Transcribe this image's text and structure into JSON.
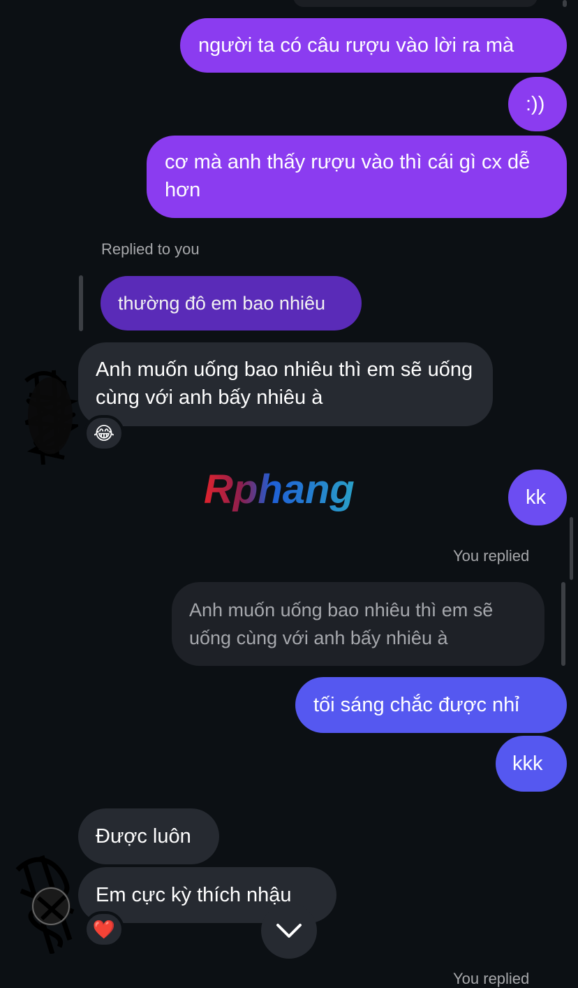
{
  "messages": {
    "m1": "người ta có câu rượu vào lời ra mà",
    "m2": ":))",
    "m3": "cơ mà anh thấy rượu vào thì cái gì cx dễ hơn",
    "replied_to_label": "Replied to you",
    "quoted1": "thường đô em bao nhiêu",
    "m4": "Anh muốn uống bao nhiêu thì em sẽ uống cùng với anh bấy nhiêu à",
    "m5": "kk",
    "you_replied_label": "You replied",
    "quoted2": "Anh muốn uống bao nhiêu thì em sẽ uống cùng với anh bấy nhiêu à",
    "m6": "tối sáng chắc được nhỉ",
    "m7": "kkk",
    "m8": "Được luôn",
    "m9": "Em cực kỳ thích nhậu",
    "you_replied_label_2": "You replied"
  },
  "reactions": {
    "r1": "😂",
    "r2": "❤️"
  },
  "watermark": "Rphang",
  "icons": {
    "scroll_down": "chevron-down-icon"
  },
  "colors": {
    "background": "#0c1014",
    "outgoing_purple": "#8b3cf0",
    "outgoing_blue": "#5558f0",
    "incoming": "#262a31"
  }
}
